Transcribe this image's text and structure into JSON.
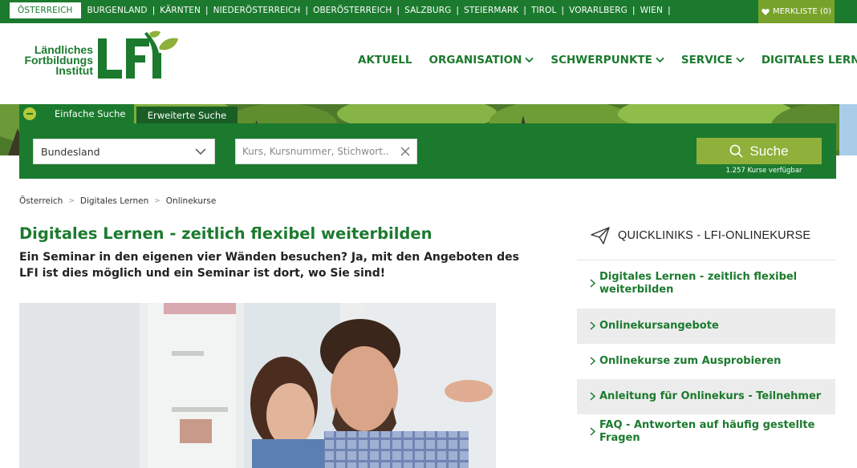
{
  "top_bar": {
    "regions": [
      "ÖSTERREICH",
      "BURGENLAND",
      "KÄRNTEN",
      "NIEDERÖSTERREICH",
      "OBERÖSTERREICH",
      "SALZBURG",
      "STEIERMARK",
      "TIROL",
      "VORARLBERG",
      "WIEN"
    ],
    "merkliste_label": "MERKLISTE (0)"
  },
  "logo": {
    "line1": "Ländliches",
    "line2": "Fortbildungs",
    "line3": "Institut",
    "mark": "LFI"
  },
  "main_nav": [
    {
      "label": "AKTUELL",
      "dropdown": false
    },
    {
      "label": "ORGANISATION",
      "dropdown": true
    },
    {
      "label": "SCHWERPUNKTE",
      "dropdown": true
    },
    {
      "label": "SERVICE",
      "dropdown": true
    },
    {
      "label": "DIGITALES LERNEN",
      "dropdown": true
    }
  ],
  "search": {
    "tab_simple": "Einfache Suche",
    "tab_advanced": "Erweiterte Suche",
    "bundesland_value": "Bundesland",
    "query_placeholder": "Kurs, Kursnummer, Stichwort...",
    "button_label": "Suche",
    "available_text": "1.257 Kurse verfügbar"
  },
  "breadcrumb": [
    "Österreich",
    "Digitales Lernen",
    "Onlinekurse"
  ],
  "content": {
    "title": "Digitales Lernen - zeitlich flexibel weiterbilden",
    "lead": "Ein Seminar in den eigenen vier Wänden besuchen? Ja, mit den Angeboten des LFI ist dies möglich und ein Seminar ist dort, wo Sie sind!"
  },
  "sidebar": {
    "title": "QUICKLINIKS - LFI-ONLINEKURSE",
    "links": [
      "Digitales Lernen - zeitlich flexibel weiterbilden",
      "Onlinekursangebote",
      "Onlinekurse zum Ausprobieren",
      "Anleitung für Onlinekurs - Teilnehmer",
      "FAQ - Antworten auf häufig gestellte Fragen"
    ]
  },
  "colors": {
    "primary_green": "#1b7a2e",
    "lime": "#8fb03a",
    "merkliste_bg": "#78a32b"
  }
}
